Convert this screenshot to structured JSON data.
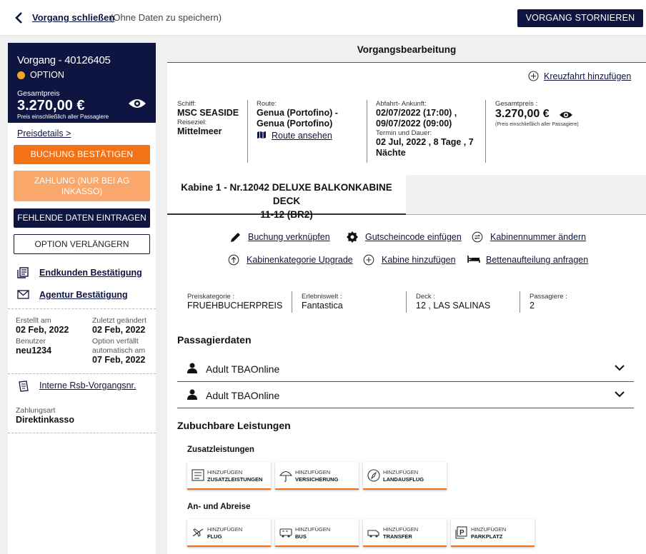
{
  "topbar": {
    "close_link": "Vorgang schließen",
    "close_hint": "(Ohne Daten zu speichern)",
    "cancel_button": "VORGANG STORNIEREN"
  },
  "sidebar": {
    "vorgang_title": "Vorgang - 40126405",
    "status": "OPTION",
    "status_color": "#f5a623",
    "total_label": "Gesamtpreis",
    "total_price": "3.270,00 €",
    "total_note": "Preis einschließlich aller Passagiere",
    "price_details_link": "Preisdetails >",
    "buttons": {
      "confirm": "BUCHUNG BESTÄTIGEN",
      "payment_line1": "ZAHLUNG (NUR BEI AG",
      "payment_line2": "INKASSO)",
      "missing_data": "FEHLENDE DATEN EINTRAGEN",
      "extend_option": "OPTION VERLÄNGERN"
    },
    "customer_confirmation": "Endkunden Bestätigung",
    "agency_confirmation": "Agentur Bestätigung",
    "meta": {
      "created_label": "Erstellt am",
      "created_value": "02 Feb, 2022",
      "changed_label": "Zuletzt geändert",
      "changed_value": "02 Feb, 2022",
      "user_label": "Benutzer",
      "user_value": "neu1234",
      "expires_label_1": "Option verfällt",
      "expires_label_2": "automatisch am",
      "expires_value": "07 Feb, 2022"
    },
    "rsb_link": "Interne Rsb-Vorgangsnr.",
    "payment_type_label": "Zahlungsart",
    "payment_type_value": "Direktinkasso"
  },
  "main": {
    "header": "Vorgangsbearbeitung",
    "add_cruise": "Kreuzfahrt hinzufügen",
    "trip": {
      "ship_label": "Schiff:",
      "ship_value": "MSC SEASIDE",
      "region_label": "Reiseziel:",
      "region_value": "Mittelmeer",
      "route_label": "Route:",
      "route_line1": "Genua (Portofino) -",
      "route_line2": "Genua (Portofino)",
      "route_link": "Route ansehen",
      "dates_label": "Abfahrt- Ankunft:",
      "dates_line1": "02/07/2022 (17:00) ,",
      "dates_line2": "09/07/2022 (09:00)",
      "term_label": "Termin und Dauer:",
      "term_line1": "02 Jul, 2022 , 8 Tage , 7",
      "term_line2": "Nächte",
      "price_label": "Gesamtpreis :",
      "price_value": "3.270,00 €",
      "price_note": "(Preis einschließlich aller Passagiere)"
    },
    "cabin_tab_line1": "Kabine  1 - Nr.12042 DELUXE BALKONKABINE DECK",
    "cabin_tab_line2": "11-12   (BR2)",
    "actions": {
      "link_booking": "Buchung verknüpfen",
      "voucher": "Gutscheincode einfügen",
      "change_cabin_no": "Kabinennummer ändern",
      "upgrade": "Kabinenkategorie Upgrade",
      "add_cabin": "Kabine hinzufügen",
      "bed_request": "Bettenaufteilung anfragen"
    },
    "cabin_info": {
      "price_cat_label": "Preiskategorie :",
      "price_cat_value": "FRUEHBUCHERPREIS",
      "experience_label": "Erlebniswelt :",
      "experience_value": "Fantastica",
      "deck_label": "Deck :",
      "deck_value": "12 , LAS SALINAS",
      "pax_label": "Passagiere :",
      "pax_value": "2"
    },
    "passengers_title": "Passagierdaten",
    "passengers": [
      {
        "name": "Adult TBAOnline"
      },
      {
        "name": "Adult TBAOnline"
      }
    ],
    "services_title": "Zubuchbare Leistungen",
    "extras_title": "Zusatzleistungen",
    "travel_title": "An- und Abreise",
    "add_prefix": "HINZUFÜGEN",
    "extras": [
      "ZUSATZLEISTUNGEN",
      "VERSICHERUNG",
      "LANDAUSFLUG"
    ],
    "travel": [
      "FLUG",
      "BUS",
      "TRANSFER",
      "PARKPLATZ"
    ],
    "accent_color": "#f47216",
    "navy_color": "#0e1540"
  }
}
